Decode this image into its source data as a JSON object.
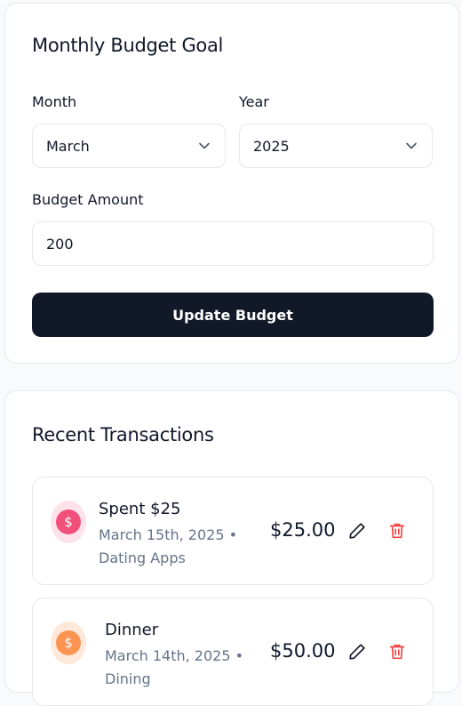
{
  "budget": {
    "title": "Monthly Budget Goal",
    "month_label": "Month",
    "month_value": "March",
    "year_label": "Year",
    "year_value": "2025",
    "amount_label": "Budget Amount",
    "amount_value": "200",
    "update_label": "Update Budget"
  },
  "transactions": {
    "title": "Recent Transactions",
    "items": [
      {
        "title": "Spent $25",
        "meta": "March 15th, 2025 • Dating Apps",
        "amount": "$25.00",
        "icon": "dollar-icon",
        "color": "#f0507a",
        "bg": "#fde2ea"
      },
      {
        "title": "Dinner",
        "meta": "March 14th, 2025 • Dining",
        "amount": "$50.00",
        "icon": "dollar-icon",
        "color": "#fb9450",
        "bg": "#fde8da"
      }
    ]
  },
  "colors": {
    "primary_button": "#111827",
    "delete_icon": "#ef4444",
    "muted_text": "#64748b"
  }
}
